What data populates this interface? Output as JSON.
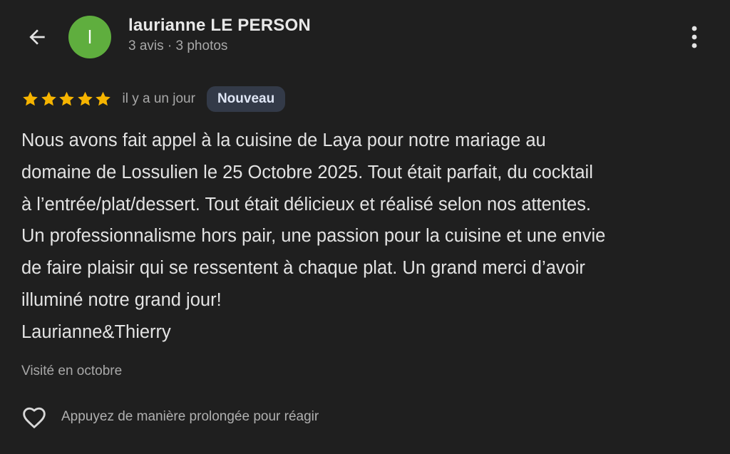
{
  "header": {
    "back_icon": "arrow-back-icon",
    "avatar_initial": "l",
    "avatar_color": "#5fae3e",
    "reviewer_name": "laurianne LE PERSON",
    "reviewer_meta": "3 avis · 3 photos",
    "more_icon": "more-vert-icon"
  },
  "review": {
    "rating": 5,
    "rating_max": 5,
    "star_color": "#f6b400",
    "time_ago": "il y a un jour",
    "badge": "Nouveau",
    "text": "Nous avons fait appel à la cuisine de Laya pour notre mariage au\ndomaine de Lossulien le 25 Octobre 2025. Tout était parfait, du cocktail\nà l’entrée/plat/dessert. Tout était délicieux et réalisé selon nos attentes.\nUn professionnalisme hors pair, une passion pour la cuisine et une envie\nde faire plaisir qui se ressentent à chaque plat. Un grand merci d’avoir\nilluminé notre grand jour!\nLaurianne&Thierry",
    "visited": "Visité en octobre"
  },
  "reaction": {
    "icon": "heart-outline-icon",
    "label": "Appuyez de manière prolongée pour réagir"
  }
}
